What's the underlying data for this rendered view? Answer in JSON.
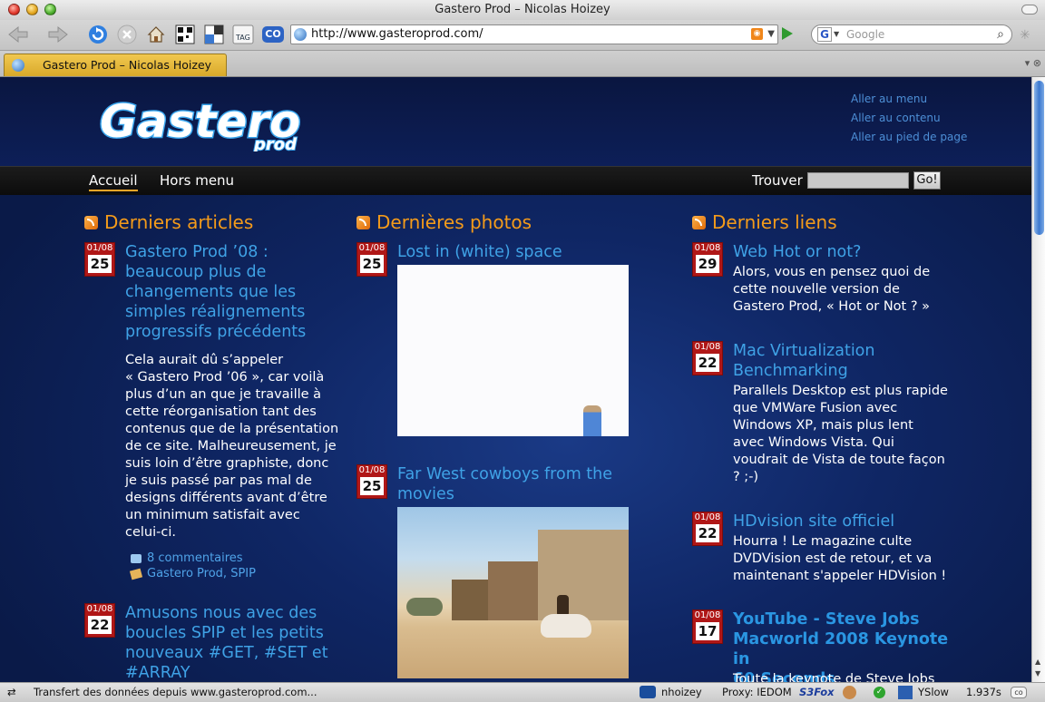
{
  "window": {
    "title": "Gastero Prod – Nicolas Hoizey"
  },
  "toolbar": {
    "url": "http://www.gasteroprod.com/",
    "search_placeholder": "Google",
    "icons": [
      "back-icon",
      "forward-icon",
      "reload-icon",
      "stop-icon",
      "home-icon",
      "tag-icon"
    ],
    "tag_label": "TAG",
    "co_label": "CO"
  },
  "tab": {
    "label": "Gastero Prod – Nicolas Hoizey"
  },
  "site": {
    "logo_text": "Gastero",
    "logo_sub": "prod",
    "skip_links": [
      "Aller au menu",
      "Aller au contenu",
      "Aller au pied de page"
    ],
    "nav": [
      "Accueil",
      "Hors menu"
    ],
    "search_label": "Trouver",
    "search_button": "Go!"
  },
  "columns": {
    "articles": {
      "heading": "Derniers articles",
      "items": [
        {
          "month": "01/08",
          "day": "25",
          "title_lines": [
            "Gastero Prod ’08 :",
            "beaucoup plus de",
            "changements que les",
            "simples réalignements",
            "progressifs précédents"
          ],
          "body_lines": [
            "Cela aurait dû s’appeler",
            "« Gastero Prod ’06 », car voilà",
            "plus d’un an que je travaille à",
            "cette réorganisation tant des",
            "contenus que de la présentation",
            "de ce site. Malheureusement, je",
            "suis loin d’être graphiste, donc",
            "je suis passé par pas mal de",
            "designs différents avant d’être",
            "un minimum satisfait avec",
            "celui-ci."
          ],
          "comments": "8 commentaires",
          "tags": "Gastero Prod, SPIP"
        },
        {
          "month": "01/08",
          "day": "22",
          "title_lines": [
            "Amusons nous avec des",
            "boucles SPIP et les petits",
            "nouveaux #GET, #SET et",
            "#ARRAY"
          ]
        }
      ]
    },
    "photos": {
      "heading": "Dernières photos",
      "items": [
        {
          "month": "01/08",
          "day": "25",
          "title_lines": [
            "Lost in (white) space"
          ]
        },
        {
          "month": "01/08",
          "day": "25",
          "title_lines": [
            "Far West cowboys from the",
            "movies"
          ]
        }
      ]
    },
    "links": {
      "heading": "Derniers liens",
      "items": [
        {
          "month": "01/08",
          "day": "29",
          "title_lines": [
            "Web Hot or not?"
          ],
          "body_lines": [
            "Alors, vous en pensez quoi de",
            "cette nouvelle version de",
            "Gastero Prod, « Hot or Not ? »"
          ]
        },
        {
          "month": "01/08",
          "day": "22",
          "title_lines": [
            "Mac Virtualization",
            "Benchmarking"
          ],
          "body_lines": [
            "Parallels Desktop est plus rapide",
            "que VMWare Fusion avec",
            "Windows XP, mais plus lent",
            "avec Windows Vista. Qui",
            "voudrait de Vista de toute façon",
            "? ;-)"
          ]
        },
        {
          "month": "01/08",
          "day": "22",
          "title_lines": [
            "HDvision site officiel"
          ],
          "body_lines": [
            "Hourra ! Le magazine culte",
            "DVDVision est de retour, et va",
            "maintenant s'appeler HDVision !"
          ]
        },
        {
          "month": "01/08",
          "day": "17",
          "title_lines": [
            "YouTube - Steve Jobs",
            "Macworld 2008 Keynote in",
            "60 Seconds"
          ],
          "body_lines": [
            "Toute la keynote de Steve Jobs"
          ]
        }
      ]
    }
  },
  "statusbar": {
    "message": "Transfert des données depuis www.gasteroprod.com...",
    "user": "nhoizey",
    "proxy": "Proxy: IEDOM",
    "s3fox": "S3Fox",
    "yslow": "YSlow",
    "time": "1.937s"
  }
}
